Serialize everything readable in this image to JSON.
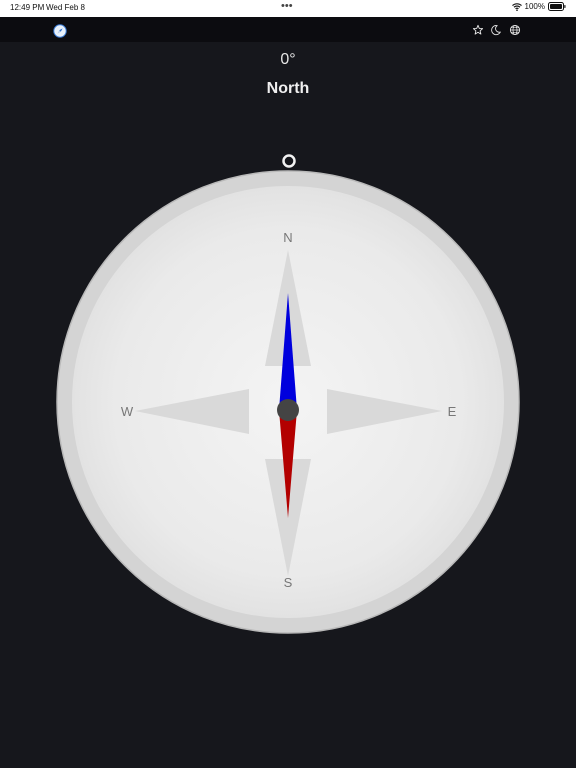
{
  "status_bar": {
    "time": "12:49 PM",
    "date": "Wed Feb 8",
    "dots": "•••",
    "battery": "100%"
  },
  "toolbar": {
    "app_icon": "compass-icon",
    "icons": [
      "star-icon",
      "moon-icon",
      "globe-icon"
    ]
  },
  "heading": {
    "degrees": "0°",
    "direction": "North"
  },
  "compass": {
    "heading_value": 0,
    "labels": {
      "n": "N",
      "e": "E",
      "s": "S",
      "w": "W"
    },
    "colors": {
      "needle_north": "#0000dd",
      "needle_south": "#b30000",
      "pivot": "#444444",
      "face": "#eeeeee",
      "rim": "#d4d4d4"
    }
  }
}
